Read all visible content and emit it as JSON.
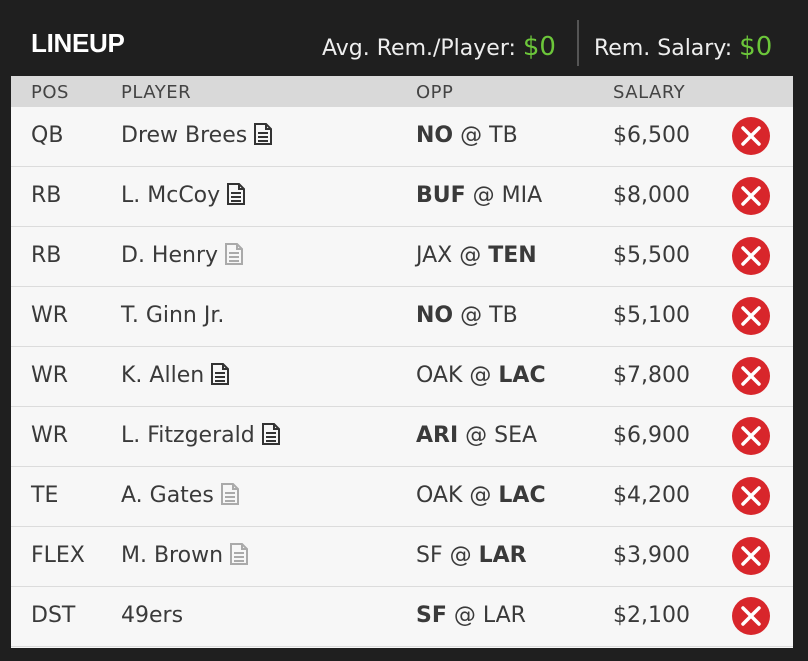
{
  "header": {
    "title": "LINEUP",
    "avg_label": "Avg. Rem./Player:",
    "avg_value": "$0",
    "rem_label": "Rem. Salary:",
    "rem_value": "$0"
  },
  "columns": {
    "pos": "POS",
    "player": "PLAYER",
    "opp": "OPP",
    "salary": "SALARY"
  },
  "rows": [
    {
      "pos": "QB",
      "player": "Drew Brees",
      "note": "dark",
      "away": "NO",
      "at": "@",
      "home": "TB",
      "bold": "away",
      "salary": "$6,500"
    },
    {
      "pos": "RB",
      "player": "L. McCoy",
      "note": "dark",
      "away": "BUF",
      "at": "@",
      "home": "MIA",
      "bold": "away",
      "salary": "$8,000"
    },
    {
      "pos": "RB",
      "player": "D. Henry",
      "note": "light",
      "away": "JAX",
      "at": "@",
      "home": "TEN",
      "bold": "home",
      "salary": "$5,500"
    },
    {
      "pos": "WR",
      "player": "T. Ginn Jr.",
      "note": "none",
      "away": "NO",
      "at": "@",
      "home": "TB",
      "bold": "away",
      "salary": "$5,100"
    },
    {
      "pos": "WR",
      "player": "K. Allen",
      "note": "dark",
      "away": "OAK",
      "at": "@",
      "home": "LAC",
      "bold": "home",
      "salary": "$7,800"
    },
    {
      "pos": "WR",
      "player": "L. Fitzgerald",
      "note": "dark",
      "away": "ARI",
      "at": "@",
      "home": "SEA",
      "bold": "away",
      "salary": "$6,900"
    },
    {
      "pos": "TE",
      "player": "A. Gates",
      "note": "light",
      "away": "OAK",
      "at": "@",
      "home": "LAC",
      "bold": "home",
      "salary": "$4,200"
    },
    {
      "pos": "FLEX",
      "player": "M. Brown",
      "note": "light",
      "away": "SF",
      "at": "@",
      "home": "LAR",
      "bold": "home",
      "salary": "$3,900"
    },
    {
      "pos": "DST",
      "player": "49ers",
      "note": "none",
      "away": "SF",
      "at": "@",
      "home": "LAR",
      "bold": "away",
      "salary": "$2,100"
    }
  ],
  "icons": {
    "note": "document-note-icon",
    "remove": "remove-x-icon"
  },
  "colors": {
    "accent_green": "#6cc63a",
    "remove_red": "#d8262b",
    "note_dark": "#333333",
    "note_light": "#aaaaaa"
  }
}
